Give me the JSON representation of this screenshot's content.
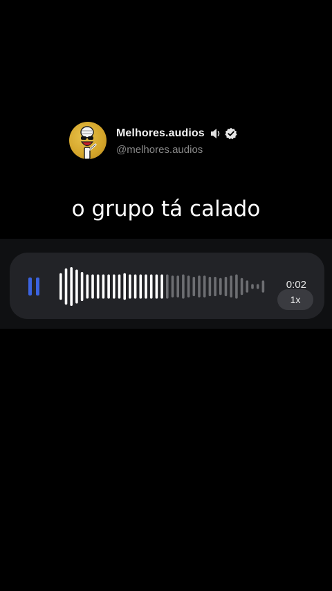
{
  "profile": {
    "display_name": "Melhores.audios",
    "handle": "@melhores.audios",
    "speaker_icon": "speaker-icon",
    "verified_icon": "verified-badge-icon"
  },
  "caption": "o grupo tá calado",
  "audio": {
    "duration": "0:02",
    "speed": "1x",
    "state": "playing",
    "progress": 0.5,
    "accent_color": "#3b63e0",
    "waveform_levels": [
      0.55,
      0.75,
      0.8,
      0.7,
      0.6,
      0.5,
      0.5,
      0.5,
      0.5,
      0.5,
      0.5,
      0.5,
      0.55,
      0.5,
      0.5,
      0.5,
      0.5,
      0.5,
      0.5,
      0.5,
      0.5,
      0.45,
      0.45,
      0.5,
      0.45,
      0.4,
      0.45,
      0.45,
      0.4,
      0.4,
      0.35,
      0.4,
      0.45,
      0.5,
      0.35,
      0.25,
      0.1,
      0.1,
      0.25
    ]
  }
}
